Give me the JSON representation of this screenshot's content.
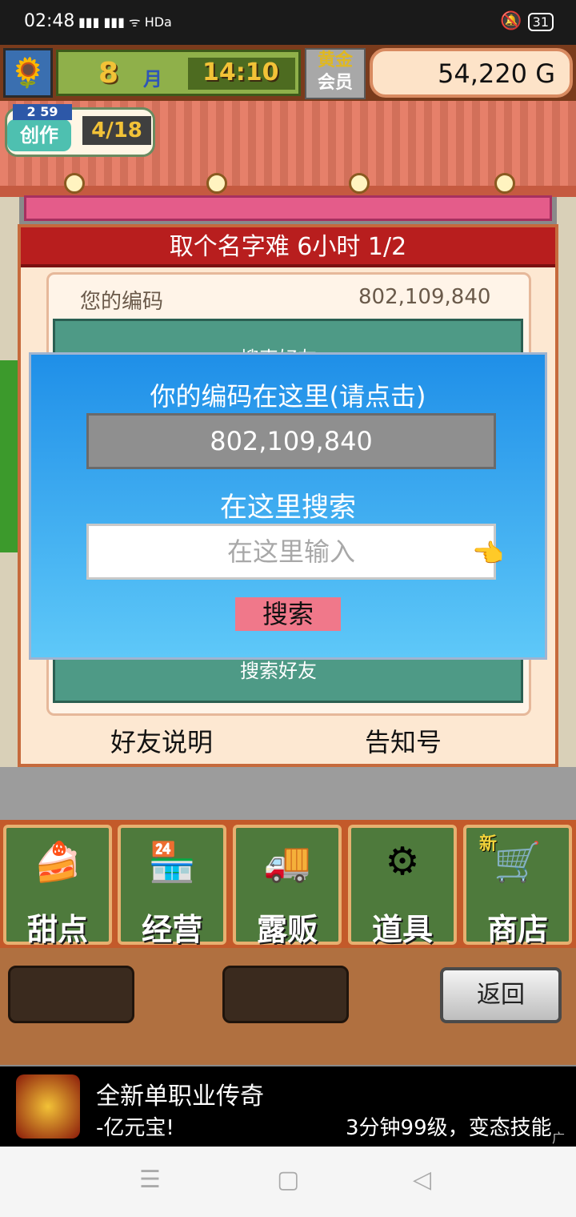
{
  "status_bar": {
    "time": "02:48",
    "signal": "4G 2G",
    "wifi": "HDa",
    "battery": "31"
  },
  "hud": {
    "avatar_icon": "sunflower-icon",
    "month_number": "8",
    "month_label": "月",
    "clock": "14:10",
    "gold_member_line1": "黄金",
    "gold_member_line2": "会员",
    "money": "54,220 G"
  },
  "craft": {
    "level": "2 59",
    "label": "创作",
    "count": "4/18"
  },
  "dialog": {
    "title": "取个名字难  6小时 1/2",
    "code_label": "您的编码",
    "code_value": "802,109,840",
    "panel_top": "搜索好友",
    "panel_bottom": "搜索好友",
    "friend_help": "好友说明",
    "notice_board": "告知号"
  },
  "overlay": {
    "title": "你的编码在这里(请点击)",
    "code_value": "802,109,840",
    "search_label": "在这里搜索",
    "search_placeholder": "在这里输入",
    "search_button": "搜索"
  },
  "menu": {
    "items": [
      {
        "label": "甜点",
        "icon": "cake-icon"
      },
      {
        "label": "经营",
        "icon": "shop-icon"
      },
      {
        "label": "露贩",
        "icon": "food-truck-icon"
      },
      {
        "label": "道具",
        "icon": "gear-bag-icon"
      },
      {
        "label": "商店",
        "icon": "cart-icon",
        "badge": "新"
      }
    ]
  },
  "bottom": {
    "back_label": "返回"
  },
  "ad": {
    "title": "全新单职业传奇",
    "subtitle": "-亿元宝!",
    "subtitle_right": "3分钟99级，变态技能",
    "tag": "广告"
  }
}
